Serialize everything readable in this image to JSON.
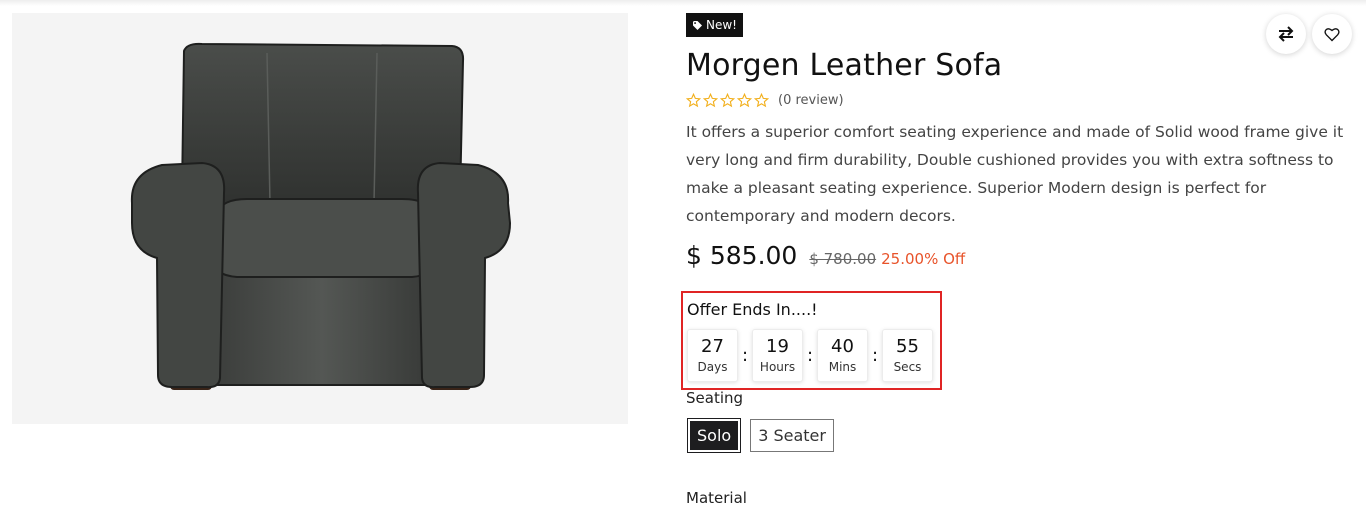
{
  "product": {
    "badge": "New!",
    "badge_icon": "tag-icon",
    "title": "Morgen Leather Sofa",
    "rating": 0,
    "rating_max": 5,
    "review_count": "(0 review)",
    "description": "It offers a superior comfort seating experience and made of Solid wood frame give it very long and firm durability, Double cushioned provides you with extra softness to make a pleasant seating experience. Superior Modern design is perfect for contemporary and modern decors.",
    "price": "$ 585.00",
    "old_price": "$ 780.00",
    "discount": "25.00% Off"
  },
  "offer": {
    "label": "Offer Ends In....!",
    "countdown": [
      {
        "value": "27",
        "unit": "Days"
      },
      {
        "value": "19",
        "unit": "Hours"
      },
      {
        "value": "40",
        "unit": "Mins"
      },
      {
        "value": "55",
        "unit": "Secs"
      }
    ],
    "separator": ":"
  },
  "variants": {
    "seating_label": "Seating",
    "seating_options": [
      "Solo",
      "3 Seater"
    ],
    "selected": "Solo",
    "material_label": "Material"
  },
  "actions": {
    "compare_icon": "compare-arrows-icon",
    "wishlist_icon": "heart-icon"
  },
  "colors": {
    "accent_discount": "#e8532a",
    "highlight_border": "#e02424",
    "star": "#f2b01e"
  }
}
